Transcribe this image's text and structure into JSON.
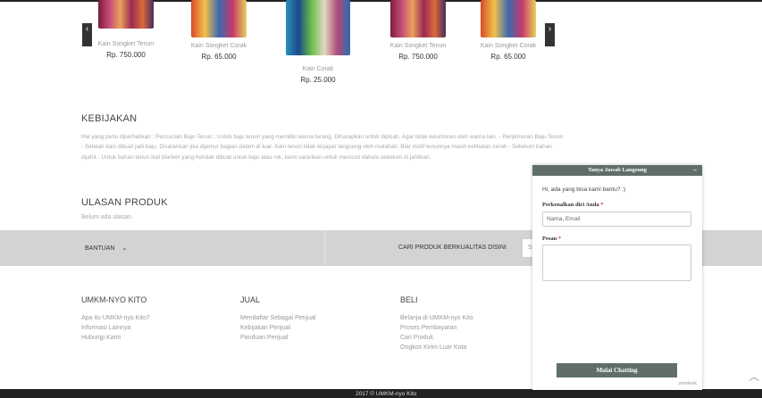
{
  "carousel": {
    "prev_icon": "chevron-left-icon",
    "next_icon": "chevron-right-icon",
    "products": [
      {
        "name": "Kain Songket Tenun",
        "price": "Rp. 750.000"
      },
      {
        "name": "Kain Songket Corak",
        "price": "Rp. 65.000"
      },
      {
        "name": "Kain Corak",
        "price": "Rp. 25.000"
      },
      {
        "name": "Kain Songket Tenun",
        "price": "Rp. 750.000"
      },
      {
        "name": "Kain Songket Corak",
        "price": "Rp. 65.000"
      }
    ]
  },
  "kebijakan": {
    "title": "KEBIJAKAN",
    "text": "Hal yang perlu diperhatikan : Pencucian Baju Tenun : Untuk baju tenun yang memiliki warna terang, Diharapkan untuk dipisah. Agar tidak kelunturan oleh warna lain. - Penjemuran Baju Tenun - Setelah kain dibuat jadi baju, Disarankan jika dijemur bagian dalam di luar. Kain tenun tidak terjapar langsung oleh matahari. Biar motif tenunnya masih kelihatan cerah - Sebelum bahan dijahit - Untuk bahan tenun ikat blanket yang hendak dibuat untuk baju atau rok, kami sarankan untuk mencuci dahulu sebelum di jahitkan."
  },
  "ulasan": {
    "title": "ULASAN PRODUK",
    "empty": "Belum ada ulasan."
  },
  "bar": {
    "bantuan": "BANTUAN",
    "bantuan_icon": "chevron-down-icon",
    "cari": "CARI PRODUK BERKUALITAS DISINI",
    "search_placeholder": "Se"
  },
  "footer": {
    "cols": [
      {
        "head": "UMKM-NYO KITO",
        "links": [
          "Apa itu UMKM-nyo Kito?",
          "Informasi Lainnya",
          "Hubungi Kami"
        ]
      },
      {
        "head": "JUAL",
        "links": [
          "Mendaftar Sebagai Penjual",
          "Kebijakan Penjual",
          "Panduan Penjual"
        ]
      },
      {
        "head": "BELI",
        "links": [
          "Belanja di UMKM-nyo Kito",
          "Proses Pembayaran",
          "Cari Produk",
          "Ongkos Kirim Luar Kota"
        ]
      }
    ],
    "copyright": "2017 © UMKM-nyo Kito"
  },
  "chat": {
    "title": "Tanya Jawab Langsung",
    "minimize": "–",
    "greeting": "Hi, ada yang bisa kami bantu? :)",
    "intro_label": "Perkenalkan diri Anda",
    "required": "*",
    "intro_value": "Nama, Email",
    "message_label": "Pesan",
    "start_button": "Mulai Chatting",
    "brand": "zendesk"
  },
  "scroll_top_icon": "chevron-up-icon"
}
